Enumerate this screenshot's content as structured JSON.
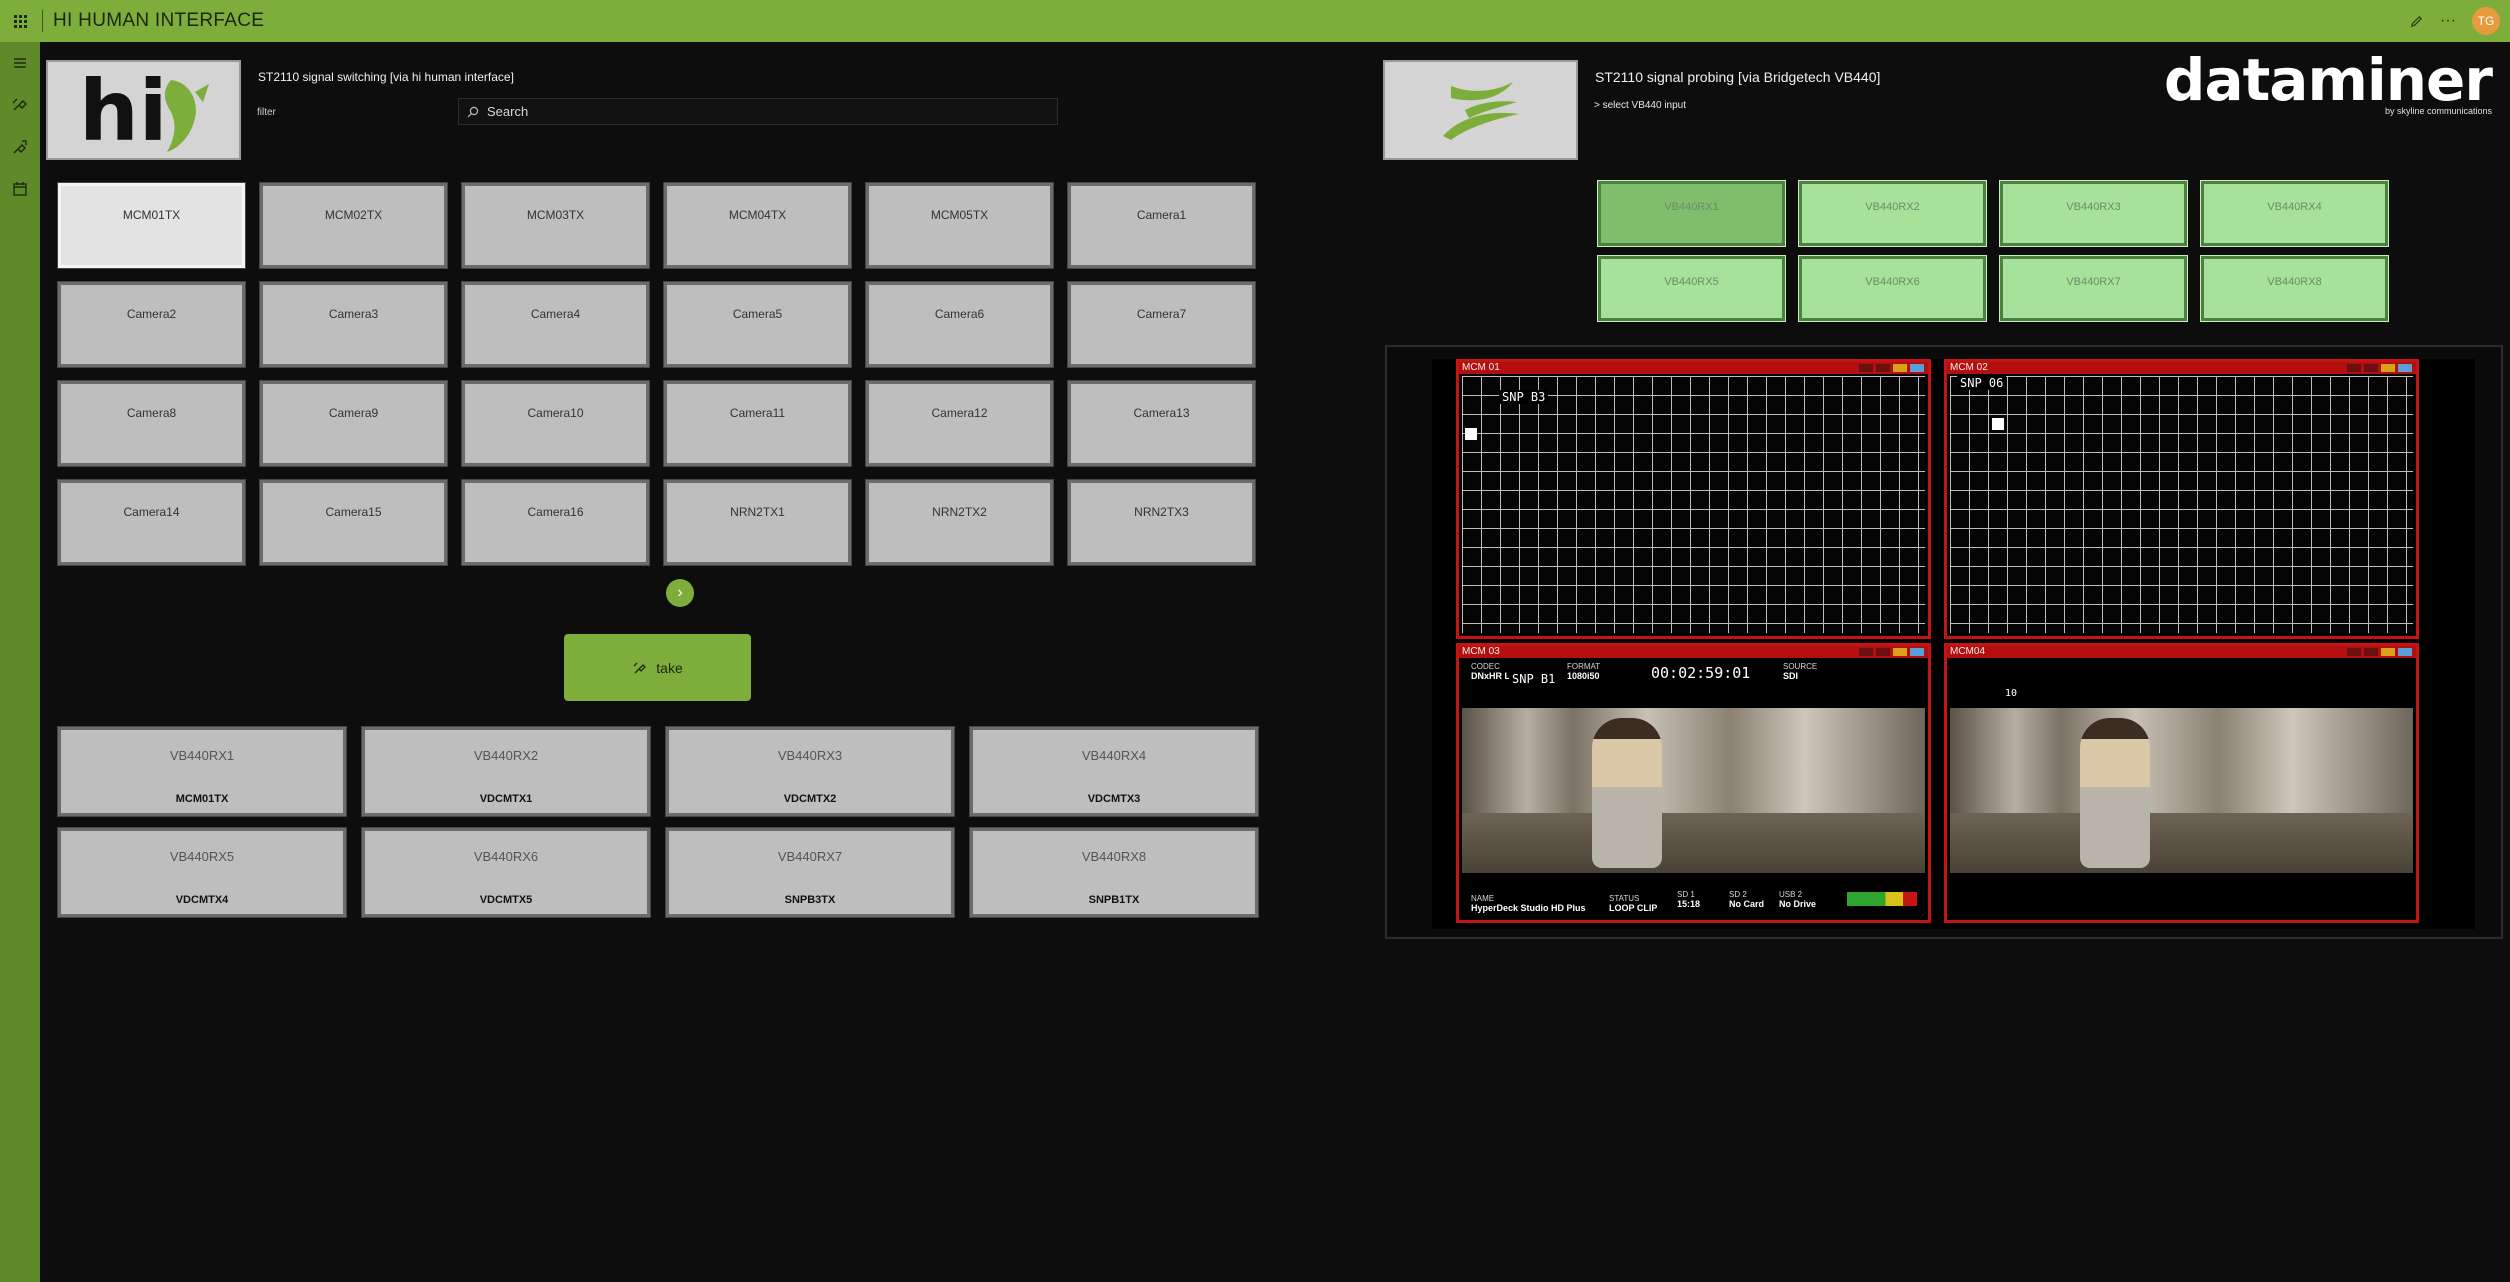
{
  "app": {
    "title": "HI HUMAN INTERFACE",
    "user_initials": "TG"
  },
  "left": {
    "title": "ST2110 signal switching [via hi human interface]",
    "filter_label": "filter",
    "search_placeholder": "Search",
    "sources": [
      {
        "label": "MCM01TX",
        "selected": true
      },
      {
        "label": "MCM02TX"
      },
      {
        "label": "MCM03TX"
      },
      {
        "label": "MCM04TX"
      },
      {
        "label": "MCM05TX"
      },
      {
        "label": "Camera1"
      },
      {
        "label": "Camera2"
      },
      {
        "label": "Camera3"
      },
      {
        "label": "Camera4"
      },
      {
        "label": "Camera5"
      },
      {
        "label": "Camera6"
      },
      {
        "label": "Camera7"
      },
      {
        "label": "Camera8"
      },
      {
        "label": "Camera9"
      },
      {
        "label": "Camera10"
      },
      {
        "label": "Camera11"
      },
      {
        "label": "Camera12"
      },
      {
        "label": "Camera13"
      },
      {
        "label": "Camera14"
      },
      {
        "label": "Camera15"
      },
      {
        "label": "Camera16"
      },
      {
        "label": "NRN2TX1"
      },
      {
        "label": "NRN2TX2"
      },
      {
        "label": "NRN2TX3"
      }
    ],
    "take_label": "take",
    "destinations": [
      {
        "name": "VB440RX1",
        "current": "MCM01TX"
      },
      {
        "name": "VB440RX2",
        "current": "VDCMTX1"
      },
      {
        "name": "VB440RX3",
        "current": "VDCMTX2"
      },
      {
        "name": "VB440RX4",
        "current": "VDCMTX3"
      },
      {
        "name": "VB440RX5",
        "current": "VDCMTX4"
      },
      {
        "name": "VB440RX6",
        "current": "VDCMTX5"
      },
      {
        "name": "VB440RX7",
        "current": "SNPB3TX"
      },
      {
        "name": "VB440RX8",
        "current": "SNPB1TX"
      }
    ]
  },
  "right": {
    "title": "ST2110 signal probing [via Bridgetech VB440]",
    "select_label": "> select VB440 input",
    "brand": {
      "word": "dataminer",
      "tagline": "by skyline communications"
    },
    "inputs": [
      {
        "label": "VB440RX1",
        "selected": true
      },
      {
        "label": "VB440RX2"
      },
      {
        "label": "VB440RX3"
      },
      {
        "label": "VB440RX4"
      },
      {
        "label": "VB440RX5"
      },
      {
        "label": "VB440RX6"
      },
      {
        "label": "VB440RX7"
      },
      {
        "label": "VB440RX8"
      }
    ],
    "multiviewer": {
      "tiles": [
        {
          "label": "MCM 01",
          "overlay": "SNP B3"
        },
        {
          "label": "MCM 02",
          "overlay": "SNP 06"
        },
        {
          "label": "MCM 03",
          "overlay": "SNP B1",
          "timecode": "00:02:59:01",
          "hud_top": [
            {
              "k": "CODEC",
              "v": "DNxHR LB"
            },
            {
              "k": "FORMAT",
              "v": "1080i50"
            },
            {
              "k": "SOURCE",
              "v": "SDI"
            }
          ],
          "hud_bottom": [
            {
              "k": "NAME",
              "v": "HyperDeck Studio HD Plus"
            },
            {
              "k": "STATUS",
              "v": "LOOP CLIP"
            },
            {
              "k": "SD 1",
              "v": "15:18"
            },
            {
              "k": "SD 2",
              "v": "No Card"
            },
            {
              "k": "USB 2",
              "v": "No Drive"
            }
          ]
        },
        {
          "label": "MCM04",
          "overlay": "10"
        }
      ]
    }
  },
  "colors": {
    "accent": "#7dad3a",
    "sidebar": "#5e8a2a",
    "probe_input": "#a6e29a",
    "tally": "#c41414"
  }
}
